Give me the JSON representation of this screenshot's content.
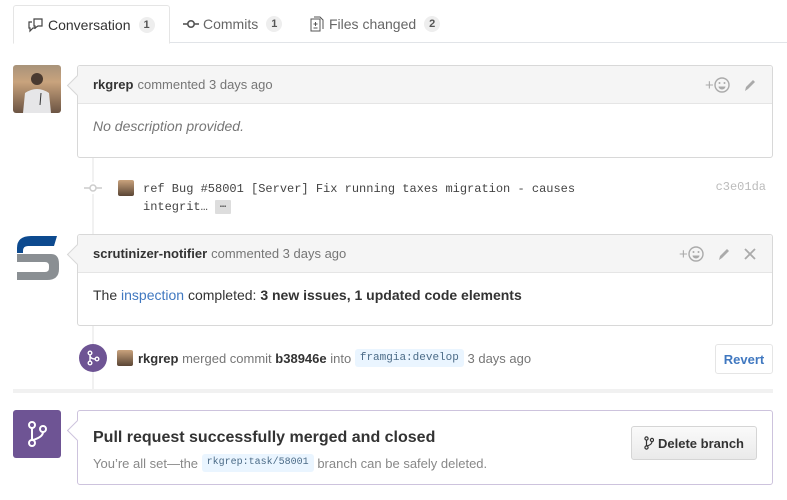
{
  "tabs": [
    {
      "label": "Conversation",
      "count": "1",
      "icon": "comment-discussion-icon",
      "selected": true
    },
    {
      "label": "Commits",
      "count": "1",
      "icon": "git-commit-icon",
      "selected": false
    },
    {
      "label": "Files changed",
      "count": "2",
      "icon": "diff-icon",
      "selected": false
    }
  ],
  "comments": [
    {
      "author": "rkgrep",
      "action": "commented 3 days ago",
      "body": "No description provided.",
      "actions": [
        "add-reaction",
        "edit"
      ]
    },
    {
      "author": "scrutinizer-notifier",
      "action": "commented 3 days ago",
      "body_prefix": "The",
      "body_link": "inspection",
      "body_mid": "completed:",
      "body_bold": "3 new issues, 1 updated code elements",
      "actions": [
        "add-reaction",
        "edit",
        "delete"
      ]
    }
  ],
  "commit": {
    "message": "ref Bug #58001 [Server] Fix running taxes migration - causes integrit…",
    "ellipsis": "…",
    "sha": "c3e01da"
  },
  "merge_event": {
    "author": "rkgrep",
    "text1": "merged commit",
    "sha": "b38946e",
    "text2": "into",
    "branch": "framgia:develop",
    "time": "3 days ago",
    "revert_label": "Revert"
  },
  "merged_status": {
    "title": "Pull request successfully merged and closed",
    "sub_prefix": "You’re all set—the",
    "branch": "rkgrep:task/58001",
    "sub_suffix": "branch can be safely deleted.",
    "delete_label": "Delete branch"
  },
  "colors": {
    "merged_purple": "#6e5494",
    "link_blue": "#4078c0",
    "scrutinizer_blue": "#0d4a8f",
    "scrutinizer_gray": "#8a8f93"
  }
}
